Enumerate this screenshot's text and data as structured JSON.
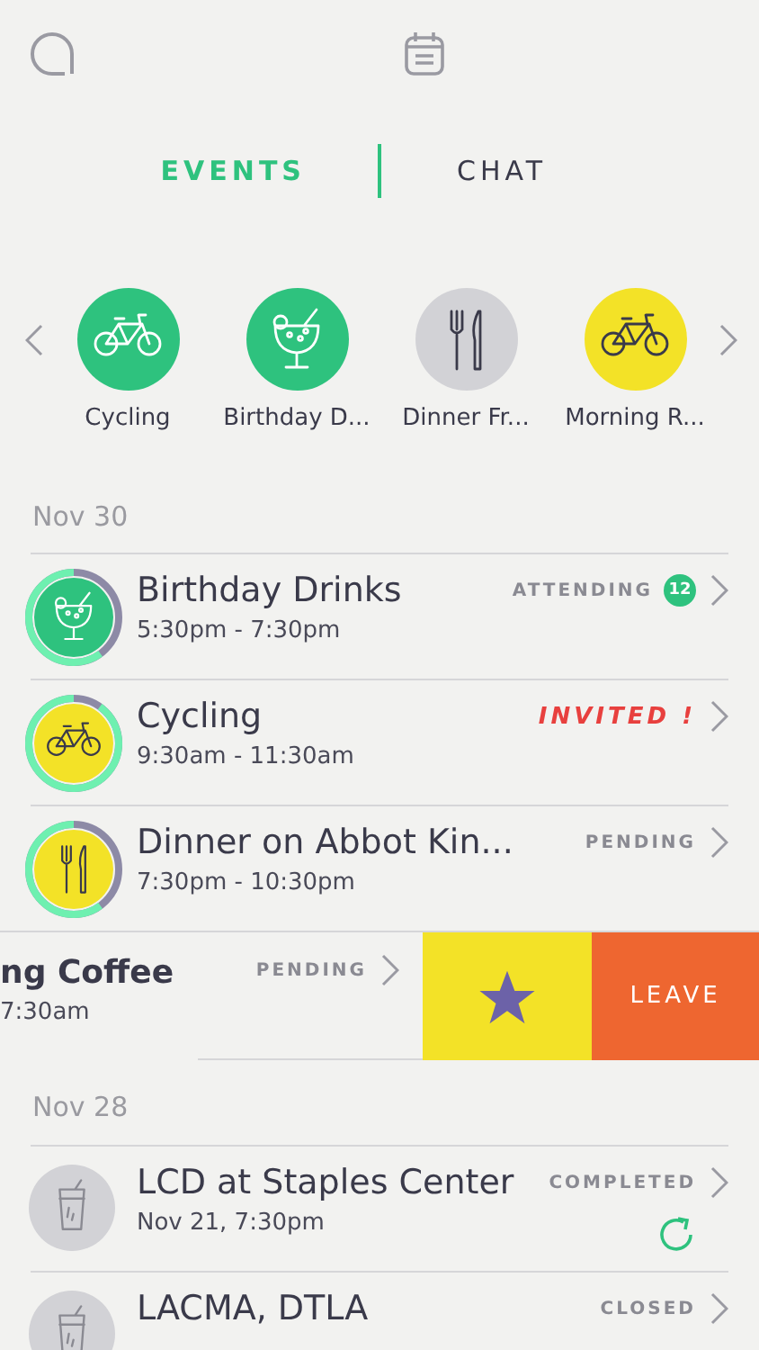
{
  "tabs": [
    {
      "label": "EVENTS",
      "selected": true
    },
    {
      "label": "CHAT",
      "selected": false
    }
  ],
  "carousel": [
    {
      "label": "Cycling",
      "kind": "bike",
      "color": "#2ec27e"
    },
    {
      "label": "Birthday D...",
      "kind": "drink",
      "color": "#2ec27e"
    },
    {
      "label": "Dinner Fr...",
      "kind": "cutlery",
      "color": "#d2d2d6"
    },
    {
      "label": "Morning R...",
      "kind": "bike",
      "color": "#f3e227"
    }
  ],
  "sections": [
    {
      "date": "Nov 30",
      "events": [
        {
          "kind": "drink",
          "title": "Birthday Drinks",
          "time": "5:30pm - 7:30pm",
          "color": "#2ec27e",
          "level": 0.6,
          "status": "ATTENDING",
          "alert": false,
          "count": "12"
        },
        {
          "kind": "bike",
          "title": "Cycling",
          "time": "9:30am - 11:30am",
          "color": "#f3e227",
          "level": 0.9,
          "status": "INVITED !",
          "alert": true
        },
        {
          "kind": "cutlery",
          "title": "Dinner on Abbot Kin...",
          "time": "7:30pm - 10:30pm",
          "color": "#f3e227",
          "level": 0.6,
          "status": "PENDING",
          "alert": false
        },
        {
          "kind": "swiped",
          "title": "ng Coffee",
          "time": "7:30am",
          "status": "PENDING",
          "alert": false,
          "action": "LEAVE"
        }
      ]
    },
    {
      "date": "Nov 28",
      "events": [
        {
          "kind": "glass",
          "title": "LCD at Staples Center",
          "time": "Nov 21, 7:30pm",
          "color": "#d2d2d6",
          "status": "COMPLETED",
          "alert": false,
          "repeatable": true
        },
        {
          "kind": "glass",
          "title": "LACMA, DTLA",
          "color": "#d2d2d6",
          "status": "CLOSED",
          "alert": false,
          "repeatable": false
        }
      ]
    }
  ]
}
